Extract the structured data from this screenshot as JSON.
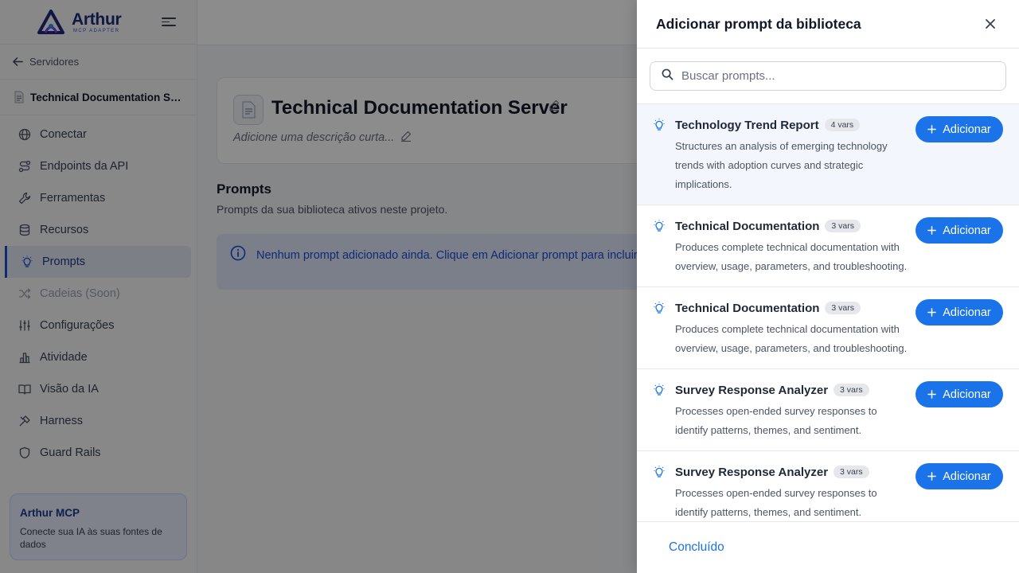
{
  "sidebar": {
    "logo_main": "Arthur",
    "logo_sub": "MCP ADAPTER",
    "back_label": "Servidores",
    "server_name": "Technical Documentation Server",
    "nav": [
      {
        "label": "Conectar",
        "icon": "globe-icon"
      },
      {
        "label": "Endpoints da API",
        "icon": "route-icon"
      },
      {
        "label": "Ferramentas",
        "icon": "wrench-icon"
      },
      {
        "label": "Recursos",
        "icon": "database-icon"
      },
      {
        "label": "Prompts",
        "icon": "lightbulb-icon",
        "active": true
      },
      {
        "label": "Cadeias (Soon)",
        "icon": "shuffle-icon",
        "disabled": true
      },
      {
        "label": "Configurações",
        "icon": "sliders-icon"
      },
      {
        "label": "Atividade",
        "icon": "bar-chart-icon"
      },
      {
        "label": "Visão da IA",
        "icon": "book-icon"
      },
      {
        "label": "Harness",
        "icon": "tools-icon"
      },
      {
        "label": "Guard Rails",
        "icon": "shield-icon"
      }
    ],
    "promo": {
      "title": "Arthur MCP",
      "description": "Conecte sua IA às suas fontes de dados"
    }
  },
  "main": {
    "server_title": "Technical Documentation Server",
    "server_desc_placeholder": "Adicione uma descrição curta...",
    "section_title": "Prompts",
    "section_subtitle": "Prompts da sua biblioteca ativos neste projeto.",
    "empty_message": "Nenhum prompt adicionado ainda. Clique em Adicionar prompt para incluir novos."
  },
  "drawer": {
    "title": "Adicionar prompt da biblioteca",
    "search_placeholder": "Buscar prompts...",
    "add_label": "Adicionar",
    "done_label": "Concluído",
    "items": [
      {
        "name": "Technology Trend Report",
        "badge": "4 vars",
        "description": "Structures an analysis of emerging technology trends with adoption curves and strategic implications.",
        "highlighted": true
      },
      {
        "name": "Technical Documentation",
        "badge": "3 vars",
        "description": "Produces complete technical documentation with overview, usage, parameters, and troubleshooting."
      },
      {
        "name": "Technical Documentation",
        "badge": "3 vars",
        "description": "Produces complete technical documentation with overview, usage, parameters, and troubleshooting."
      },
      {
        "name": "Survey Response Analyzer",
        "badge": "3 vars",
        "description": "Processes open-ended survey responses to identify patterns, themes, and sentiment."
      },
      {
        "name": "Survey Response Analyzer",
        "badge": "3 vars",
        "description": "Processes open-ended survey responses to identify patterns, themes, and sentiment."
      }
    ]
  },
  "colors": {
    "primary": "#1a73e8",
    "brand_navy": "#1e2a78",
    "highlight_row": "#f3f6fd",
    "info_bg": "#dfe7fb"
  }
}
